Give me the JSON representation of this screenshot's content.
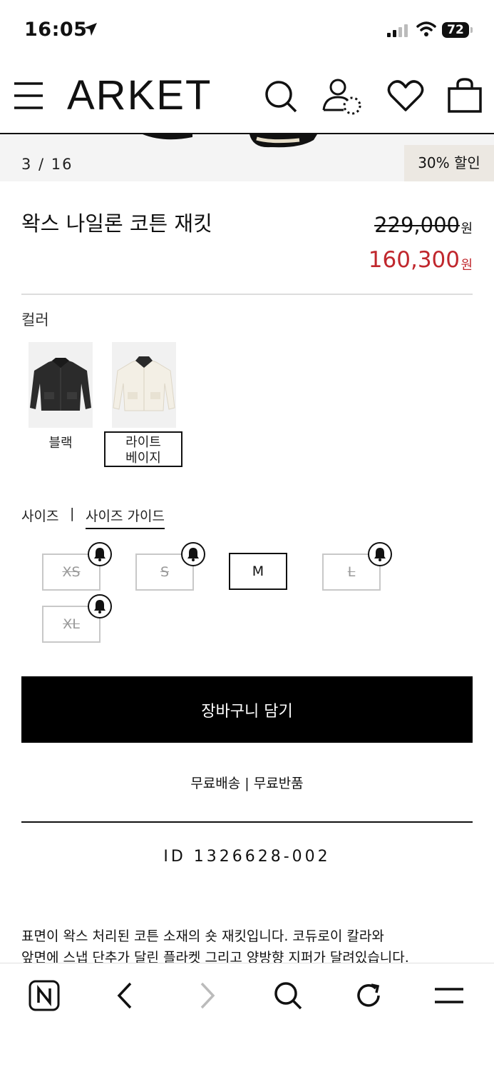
{
  "status": {
    "time": "16:05",
    "battery": "72"
  },
  "header": {
    "logo": "ARKET"
  },
  "gallery": {
    "counter": "3 / 16",
    "badge": "30% 할인"
  },
  "product": {
    "title": "왁스 나일론 코튼 재킷",
    "original_price": "229,000",
    "sale_price": "160,300",
    "currency": "원",
    "sale_color": "#c0272d"
  },
  "colors": {
    "label": "컬러",
    "options": [
      {
        "name": "블랙",
        "selected": false
      },
      {
        "name": "라이트\n베이지",
        "name_line1": "라이트",
        "name_line2": "베이지",
        "selected": true
      }
    ]
  },
  "sizes": {
    "label": "사이즈",
    "separator": "|",
    "guide": "사이즈 가이드",
    "options": [
      {
        "name": "XS",
        "available": false
      },
      {
        "name": "S",
        "available": false
      },
      {
        "name": "M",
        "available": true
      },
      {
        "name": "L",
        "available": false
      },
      {
        "name": "XL",
        "available": false
      }
    ]
  },
  "cart": {
    "label": "장바구니 담기"
  },
  "shipping": {
    "text": "무료배송 | 무료반품"
  },
  "product_id": {
    "text": "ID  1326628-002"
  },
  "description": {
    "line1": "표면이 왁스 처리된 코튼 소재의 숏 재킷입니다. 코듀로이 칼라와",
    "line2": "앞면에 스냅 단추가 달린 플라켓 그리고 양방향 지퍼가 달려있습니다."
  },
  "icons": [
    "menu-icon",
    "search-icon",
    "account-icon",
    "wishlist-icon",
    "bag-icon",
    "bell-icon",
    "naver-icon",
    "back-icon",
    "forward-icon",
    "refresh-icon",
    "more-icon"
  ]
}
